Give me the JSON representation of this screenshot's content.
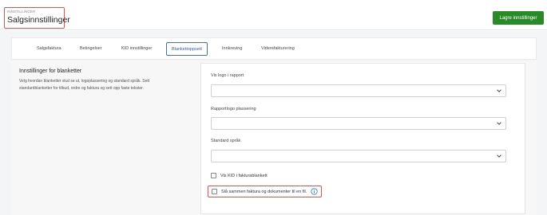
{
  "header": {
    "breadcrumb": "INNSTILLINGER",
    "title": "Salgsinnstillinger",
    "save_label": "Lagre innstillinger",
    "save_color": "#2a8a2a",
    "highlight_color": "#d9534f"
  },
  "tabs": [
    {
      "label": "Salgsfaktura",
      "active": false
    },
    {
      "label": "Betingelser",
      "active": false
    },
    {
      "label": "KID innstillinger",
      "active": false
    },
    {
      "label": "Blankettoppsett",
      "active": true
    },
    {
      "label": "Innkreving",
      "active": false
    },
    {
      "label": "Viderefakturering",
      "active": false
    }
  ],
  "section": {
    "title": "Innstillinger for blanketter",
    "description": "Velg hvordan blanketter skal se ut, logoplassering og standard språk. Sett standardblanketter for tilbud, ordre og faktura og sett opp faste tekster."
  },
  "form": {
    "fields": [
      {
        "label": "Vis logo i rapport",
        "value": "",
        "icon": "chevron-down-icon"
      },
      {
        "label": "Rapportlogo plassering",
        "value": "",
        "icon": "chevron-down-icon"
      },
      {
        "label": "Standard språk",
        "value": "",
        "icon": "chevron-down-icon"
      }
    ],
    "checkboxes": [
      {
        "label": "Vis KID i fakturablankett",
        "checked": false
      },
      {
        "label": "Slå sammen faktura og dokumenter til en fil.",
        "checked": false,
        "icon": "info-icon"
      }
    ]
  }
}
